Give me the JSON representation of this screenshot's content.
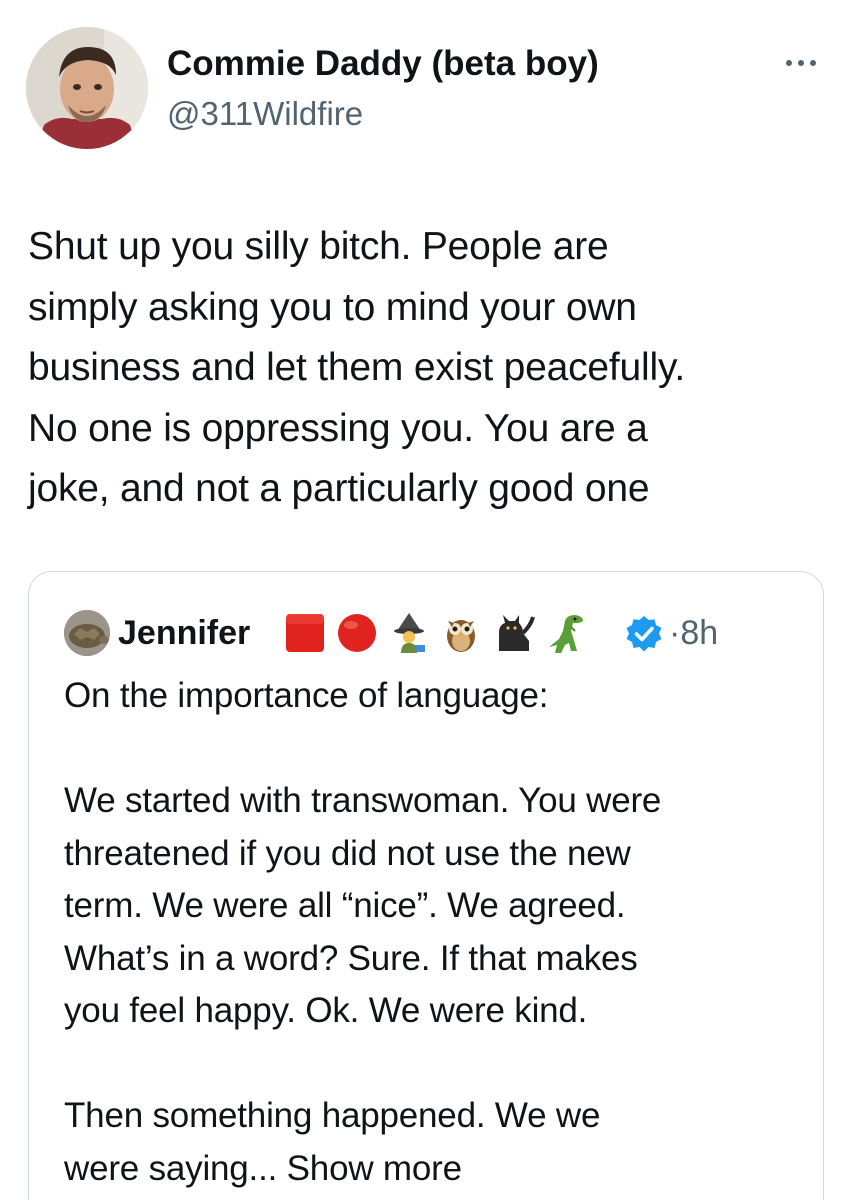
{
  "author": {
    "display_name": "Commie Daddy (beta boy)",
    "handle": "@311Wildfire",
    "avatar_icon": "profile-photo"
  },
  "menu": {
    "more_icon": "more-horizontal-icon"
  },
  "tweet": {
    "text": "Shut up you silly bitch. People are\nsimply asking you to mind your own\nbusiness and let them exist peacefully.\nNo one is oppressing you. You are a\njoke, and not a particularly good one"
  },
  "quoted_tweet": {
    "author_name": "Jennifer",
    "name_emojis": [
      "red-square",
      "red-circle",
      "mage",
      "owl",
      "black-cat",
      "t-rex"
    ],
    "verified_icon": "verified-badge-icon",
    "time_separator": "·",
    "time": "8h",
    "text": "On the importance of language:\n\nWe started with transwoman.  You were\nthreatened if you did not use the new\nterm.  We were all “nice”.  We agreed.\nWhat’s in a word?  Sure.  If that makes\nyou feel happy.   Ok.  We were kind.\n\nThen something happened.  We we\nwere saying... ",
    "show_more_label": "Show more"
  },
  "colors": {
    "text_primary": "#0f1419",
    "text_secondary": "#536471",
    "border": "#cfd9de",
    "verified": "#1d9bf0"
  }
}
